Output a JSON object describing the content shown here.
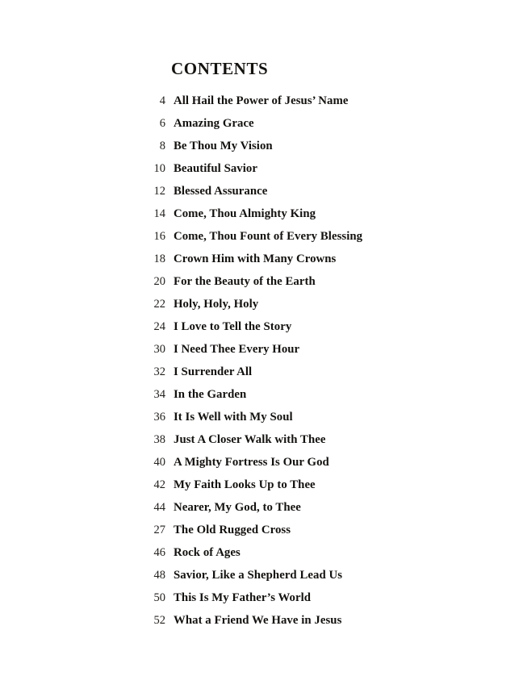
{
  "document": {
    "heading": "CONTENTS",
    "background_color": "#ffffff",
    "text_color": "#14120f"
  },
  "contents": {
    "entries": [
      {
        "page": "4",
        "title": "All Hail the Power of Jesus’ Name"
      },
      {
        "page": "6",
        "title": "Amazing Grace"
      },
      {
        "page": "8",
        "title": "Be Thou My Vision"
      },
      {
        "page": "10",
        "title": "Beautiful Savior"
      },
      {
        "page": "12",
        "title": "Blessed Assurance"
      },
      {
        "page": "14",
        "title": "Come, Thou Almighty King"
      },
      {
        "page": "16",
        "title": "Come, Thou Fount of Every Blessing"
      },
      {
        "page": "18",
        "title": "Crown Him with Many Crowns"
      },
      {
        "page": "20",
        "title": "For the Beauty of the Earth"
      },
      {
        "page": "22",
        "title": "Holy, Holy, Holy"
      },
      {
        "page": "24",
        "title": "I Love to Tell the Story"
      },
      {
        "page": "30",
        "title": "I Need Thee Every Hour"
      },
      {
        "page": "32",
        "title": "I Surrender All"
      },
      {
        "page": "34",
        "title": "In the Garden"
      },
      {
        "page": "36",
        "title": "It Is Well with My Soul"
      },
      {
        "page": "38",
        "title": "Just A Closer Walk with Thee"
      },
      {
        "page": "40",
        "title": "A Mighty Fortress Is Our God"
      },
      {
        "page": "42",
        "title": "My Faith Looks Up to Thee"
      },
      {
        "page": "44",
        "title": "Nearer, My God, to Thee"
      },
      {
        "page": "27",
        "title": "The Old Rugged Cross"
      },
      {
        "page": "46",
        "title": "Rock of Ages"
      },
      {
        "page": "48",
        "title": "Savior, Like a Shepherd Lead Us"
      },
      {
        "page": "50",
        "title": "This Is My Father’s World"
      },
      {
        "page": "52",
        "title": "What a Friend We Have in Jesus"
      }
    ]
  }
}
